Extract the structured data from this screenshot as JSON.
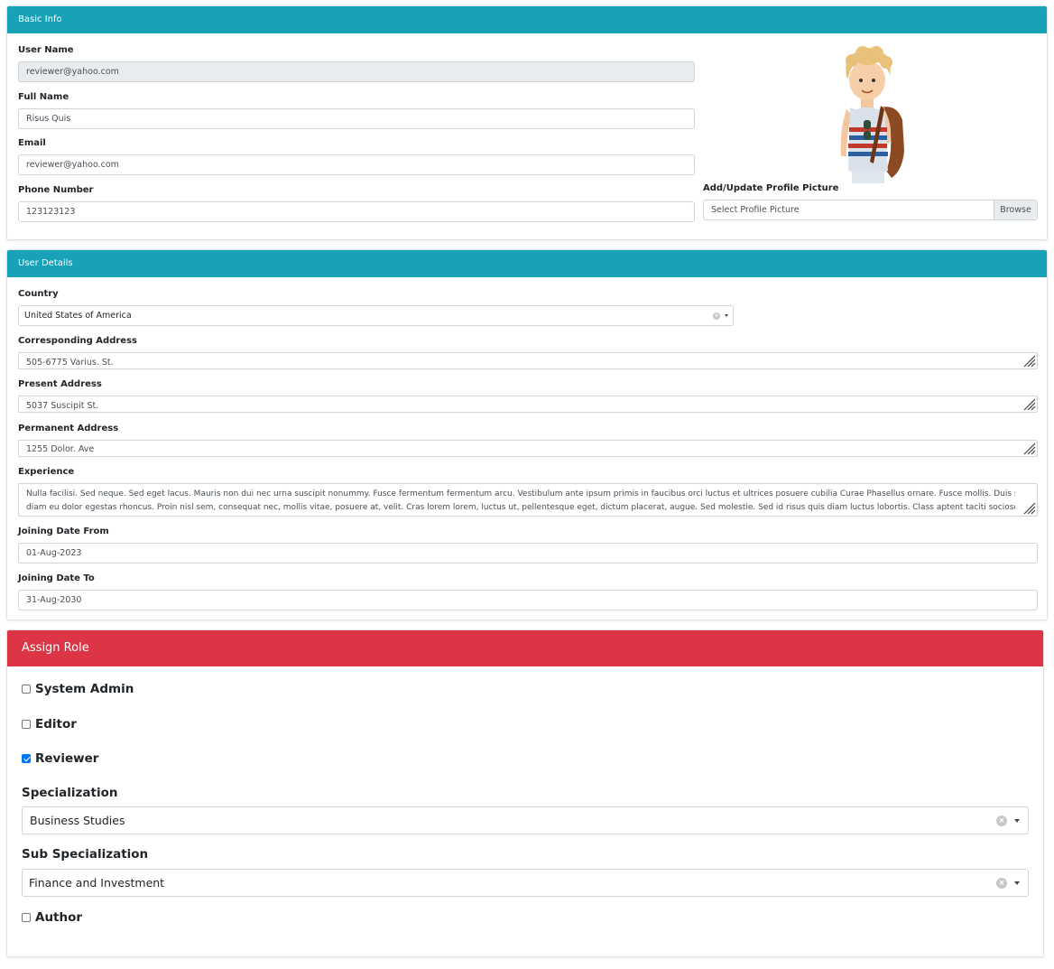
{
  "basic_info": {
    "header": "Basic Info",
    "username_label": "User Name",
    "username_value": "reviewer@yahoo.com",
    "fullname_label": "Full Name",
    "fullname_value": "Risus Quis",
    "email_label": "Email",
    "email_value": "reviewer@yahoo.com",
    "phone_label": "Phone Number",
    "phone_value": "123123123",
    "picture_label": "Add/Update Profile Picture",
    "picture_placeholder": "Select Profile Picture",
    "browse_label": "Browse",
    "avatar_icon": "avatar-cartoon-boy"
  },
  "user_details": {
    "header": "User Details",
    "country_label": "Country",
    "country_value": "United States of America",
    "corresponding_label": "Corresponding Address",
    "corresponding_value": "505-6775 Varius. St.",
    "present_label": "Present Address",
    "present_value": "5037 Suscipit St.",
    "permanent_label": "Permanent Address",
    "permanent_value": "1255 Dolor. Ave",
    "experience_label": "Experience",
    "experience_line1": "Nulla facilisi. Sed neque. Sed eget lacus. Mauris non dui nec urna suscipit nonummy. Fusce fermentum fermentum arcu. Vestibulum ante ipsum primis in faucibus orci luctus et ultrices posuere cubilia Curae Phasellus ornare. Fusce mollis. Duis sit amet",
    "experience_line2": "diam eu dolor egestas rhoncus. Proin nisl sem, consequat nec, mollis vitae, posuere at, velit. Cras lorem lorem, luctus ut, pellentesque eget, dictum placerat, augue. Sed molestie. Sed id risus quis diam luctus lobortis. Class aptent taciti sociosqu ad litora",
    "join_from_label": "Joining Date From",
    "join_from_value": "01-Aug-2023",
    "join_to_label": "Joining Date To",
    "join_to_value": "31-Aug-2030"
  },
  "assign_role": {
    "header": "Assign Role",
    "roles": [
      {
        "label": "System Admin",
        "checked": false
      },
      {
        "label": "Editor",
        "checked": false
      },
      {
        "label": "Reviewer",
        "checked": true
      },
      {
        "label": "Author",
        "checked": false
      }
    ],
    "specialization_label": "Specialization",
    "specialization_value": "Business Studies",
    "sub_specialization_label": "Sub Specialization",
    "sub_specialization_value": "Finance and Investment"
  },
  "colors": {
    "info_header": "#17a2b8",
    "danger_header": "#dc3545",
    "checkbox_checked": "#0075ff"
  }
}
